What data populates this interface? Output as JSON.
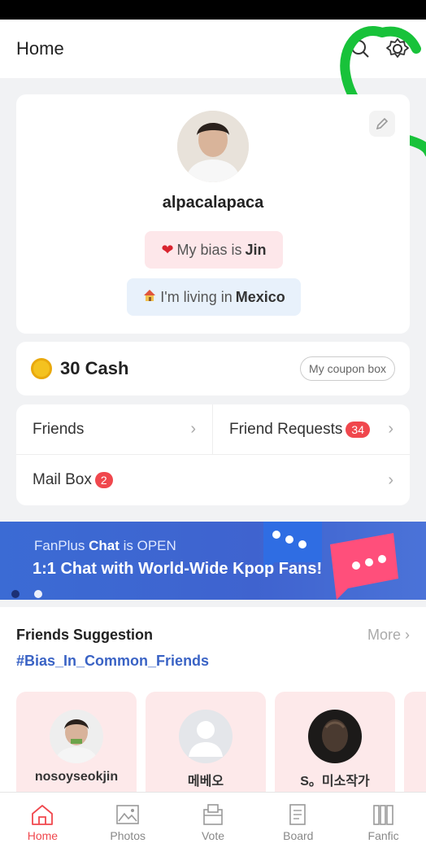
{
  "header": {
    "title": "Home",
    "search_icon": "search-icon",
    "settings_icon": "gear-icon"
  },
  "profile": {
    "username": "alpacalapaca",
    "bias_prefix": "My bias is",
    "bias_name": "Jin",
    "living_prefix": "I'm living in",
    "living_place": "Mexico"
  },
  "wallet": {
    "cash_label": "30 Cash",
    "coupon_label": "My coupon box"
  },
  "menu": {
    "friends": "Friends",
    "friend_requests": "Friend Requests",
    "friend_requests_count": "34",
    "mailbox": "Mail Box",
    "mailbox_count": "2"
  },
  "banner": {
    "sub_prefix": "FanPlus",
    "sub_bold": "Chat",
    "sub_suffix": "is OPEN",
    "headline": "1:1 Chat with World-Wide Kpop Fans!"
  },
  "suggestions": {
    "title": "Friends Suggestion",
    "more": "More",
    "hashtag": "#Bias_In_Common_Friends",
    "items": [
      {
        "name": "nosoyseokjin"
      },
      {
        "name": "메베오"
      },
      {
        "name": "S。미소작가"
      }
    ]
  },
  "tabs": [
    {
      "label": "Home",
      "icon": "home-icon"
    },
    {
      "label": "Photos",
      "icon": "photo-icon"
    },
    {
      "label": "Vote",
      "icon": "vote-icon"
    },
    {
      "label": "Board",
      "icon": "board-icon"
    },
    {
      "label": "Fanfic",
      "icon": "books-icon"
    }
  ],
  "colors": {
    "accent": "#f0474d",
    "link": "#3a63c5",
    "banner": "#3f63cf",
    "annotation": "#18c23a"
  }
}
